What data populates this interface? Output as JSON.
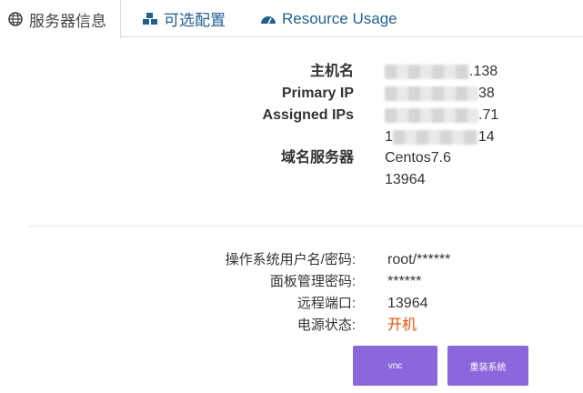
{
  "tabs": [
    {
      "label": "服务器信息",
      "icon": "globe-icon",
      "active": true
    },
    {
      "label": "可选配置",
      "icon": "cubes-icon",
      "active": false
    },
    {
      "label": "Resource Usage",
      "icon": "gauge-icon",
      "active": false
    }
  ],
  "server_info": {
    "hostname_label": "主机名",
    "hostname_value_suffix": ".138",
    "primary_ip_label": "Primary IP",
    "primary_ip_value_suffix": "38",
    "assigned_ips_label": "Assigned IPs",
    "assigned_ip_1_suffix": ".71",
    "assigned_ip_2_prefix": "1",
    "assigned_ip_2_suffix": "14",
    "nameserver_label": "域名服务器",
    "nameserver_1": "Centos7.6",
    "nameserver_2": "13964"
  },
  "account": {
    "os_user_label": "操作系统用户名/密码:",
    "os_user_value": "root/******",
    "panel_pwd_label": "面板管理密码:",
    "panel_pwd_value": "******",
    "remote_port_label": "远程端口:",
    "remote_port_value": "13964",
    "power_label": "电源状态:",
    "power_value": "开机"
  },
  "buttons": {
    "vnc": "vnc",
    "reinstall": "重装系统"
  },
  "colors": {
    "accent": "#8b67dd",
    "link": "#1f5f96",
    "power_on": "#ff4a00"
  }
}
